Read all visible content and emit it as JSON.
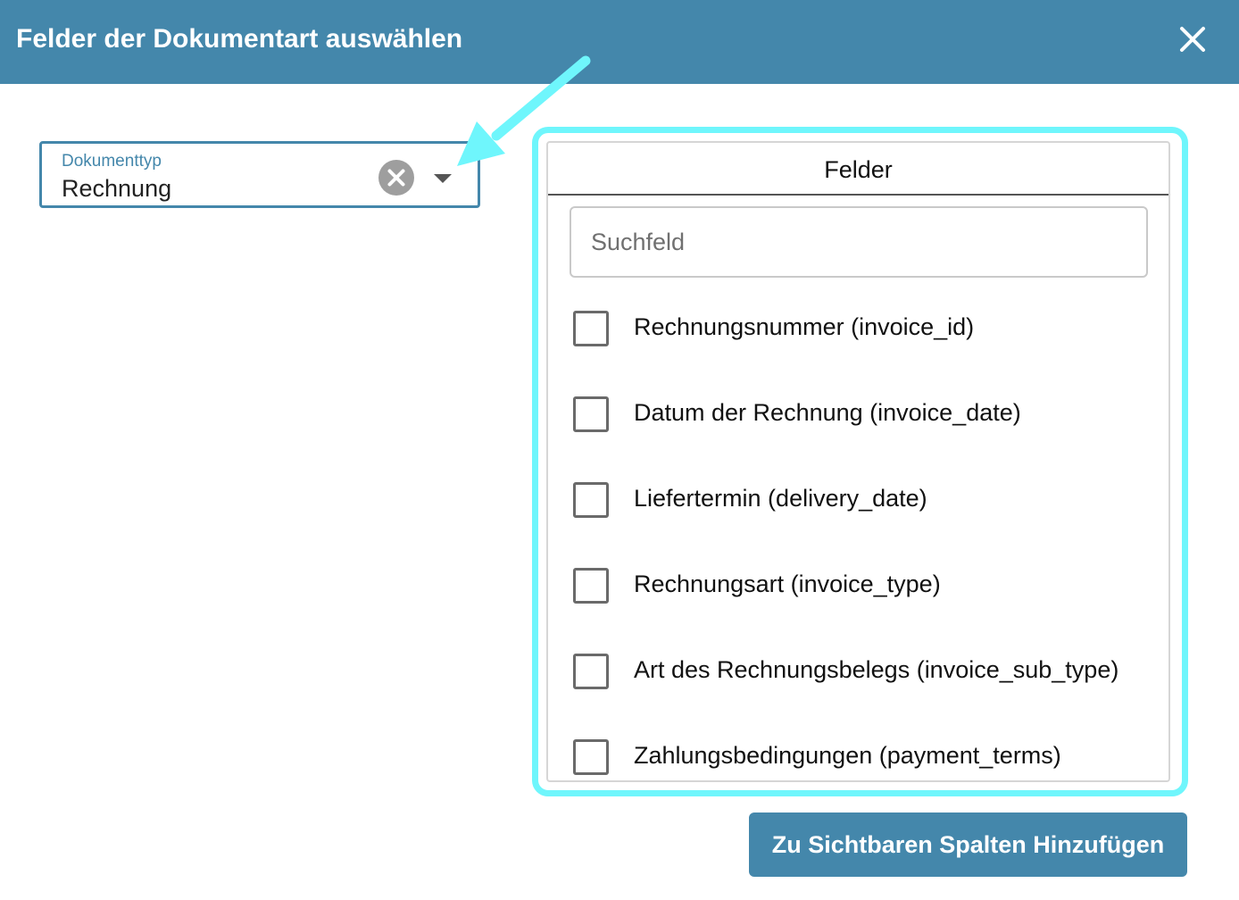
{
  "dialog": {
    "title": "Felder der Dokumentart auswählen",
    "close_icon": "close-icon",
    "header_color": "#4487ab"
  },
  "document_type_select": {
    "label": "Dokumenttyp",
    "value": "Rechnung",
    "clear_icon": "clear-circle-icon",
    "dropdown_icon": "caret-down-icon"
  },
  "fields_panel": {
    "title": "Felder",
    "search_placeholder": "Suchfeld",
    "search_value": "",
    "items": [
      {
        "label": "Rechnungsnummer (invoice_id)",
        "checked": false
      },
      {
        "label": "Datum der Rechnung (invoice_date)",
        "checked": false
      },
      {
        "label": "Liefertermin (delivery_date)",
        "checked": false
      },
      {
        "label": "Rechnungsart (invoice_type)",
        "checked": false
      },
      {
        "label": "Art des Rechnungsbelegs (invoice_sub_type)",
        "checked": false
      },
      {
        "label": "Zahlungsbedingungen (payment_terms)",
        "checked": false
      }
    ]
  },
  "actions": {
    "add_button_label": "Zu Sichtbaren Spalten Hinzufügen"
  },
  "annotation": {
    "highlight_color": "#6ff6fc",
    "arrow_icon": "annotation-arrow-icon"
  }
}
